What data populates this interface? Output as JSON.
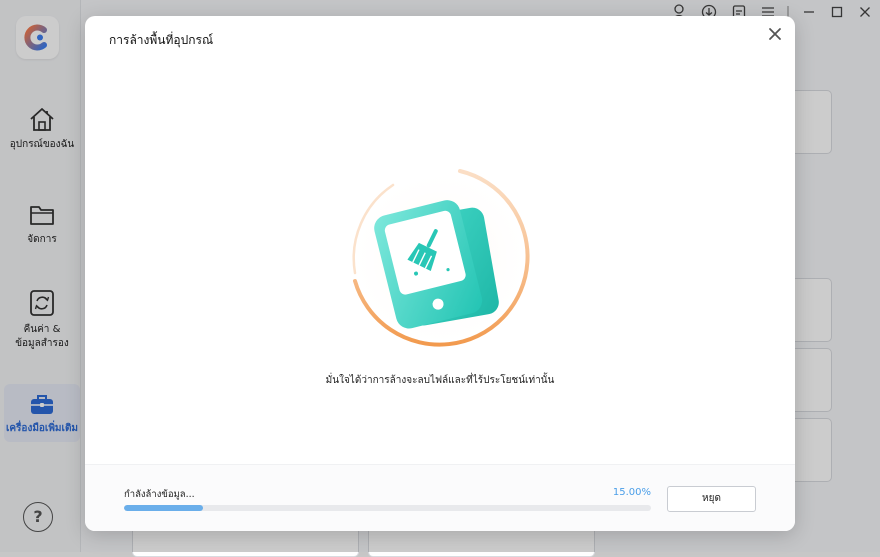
{
  "sidebar": {
    "items": [
      {
        "label": "อุปกรณ์ของฉัน",
        "icon": "home-icon"
      },
      {
        "label": "จัดการ",
        "icon": "folder-icon"
      },
      {
        "label_lines": [
          "คืนค่า &",
          "ข้อมูลสำรอง"
        ],
        "icon": "restore-icon"
      },
      {
        "label": "เครื่องมือเพิ่มเติม",
        "icon": "toolbox-icon",
        "active": true
      }
    ],
    "help_label": "?"
  },
  "modal": {
    "title": "การล้างพื้นที่อุปกรณ์",
    "hint": "มั่นใจได้ว่าการล้างจะลบไฟล์และที่ไร้ประโยชน์เท่านั้น",
    "status": "กำลังล้างข้อมูล...",
    "progress_percent": 15.0,
    "progress_label": "15.00%",
    "stop_label": "หยุด"
  },
  "colors": {
    "accent": "#2d6bd6",
    "progress": "#6aaeea",
    "percent_text": "#4a9ee8",
    "teal": "#2fd0c0",
    "ring": "#f5a35c"
  }
}
